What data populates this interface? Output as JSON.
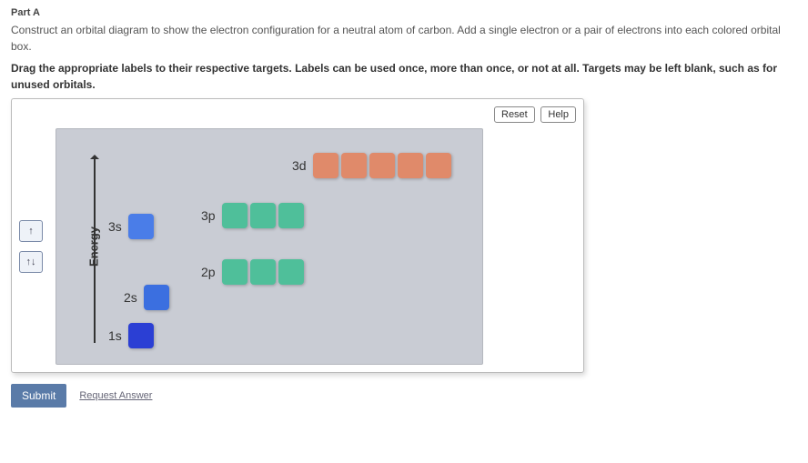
{
  "part_label": "Part A",
  "instruction_line1": "Construct an orbital diagram to show the electron configuration for a neutral atom of carbon. Add a single electron or a pair of electrons into each colored orbital box.",
  "instruction_line2": "Drag the appropriate labels to their respective targets. Labels can be used once, more than once, or not at all. Targets may be left blank, such as for unused orbitals.",
  "buttons": {
    "reset": "Reset",
    "help": "Help",
    "submit": "Submit",
    "request": "Request Answer"
  },
  "palette": {
    "single": "↑",
    "pair": "↑↓"
  },
  "axis_label": "Energy",
  "orbitals": {
    "s1": "1s",
    "s2": "2s",
    "s3": "3s",
    "p2": "2p",
    "p3": "3p",
    "d3": "3d"
  },
  "chart_data": {
    "type": "diagram",
    "description": "Atomic orbital energy diagram",
    "y_axis": "Energy (increasing upward)",
    "levels": [
      {
        "label": "1s",
        "boxes": 1,
        "color": "blue",
        "relative_energy": 1
      },
      {
        "label": "2s",
        "boxes": 1,
        "color": "blue",
        "relative_energy": 2
      },
      {
        "label": "2p",
        "boxes": 3,
        "color": "green",
        "relative_energy": 3
      },
      {
        "label": "3s",
        "boxes": 1,
        "color": "blue",
        "relative_energy": 4
      },
      {
        "label": "3p",
        "boxes": 3,
        "color": "green",
        "relative_energy": 5
      },
      {
        "label": "3d",
        "boxes": 5,
        "color": "red",
        "relative_energy": 6
      }
    ],
    "draggable_labels": [
      "↑",
      "↑↓"
    ]
  }
}
